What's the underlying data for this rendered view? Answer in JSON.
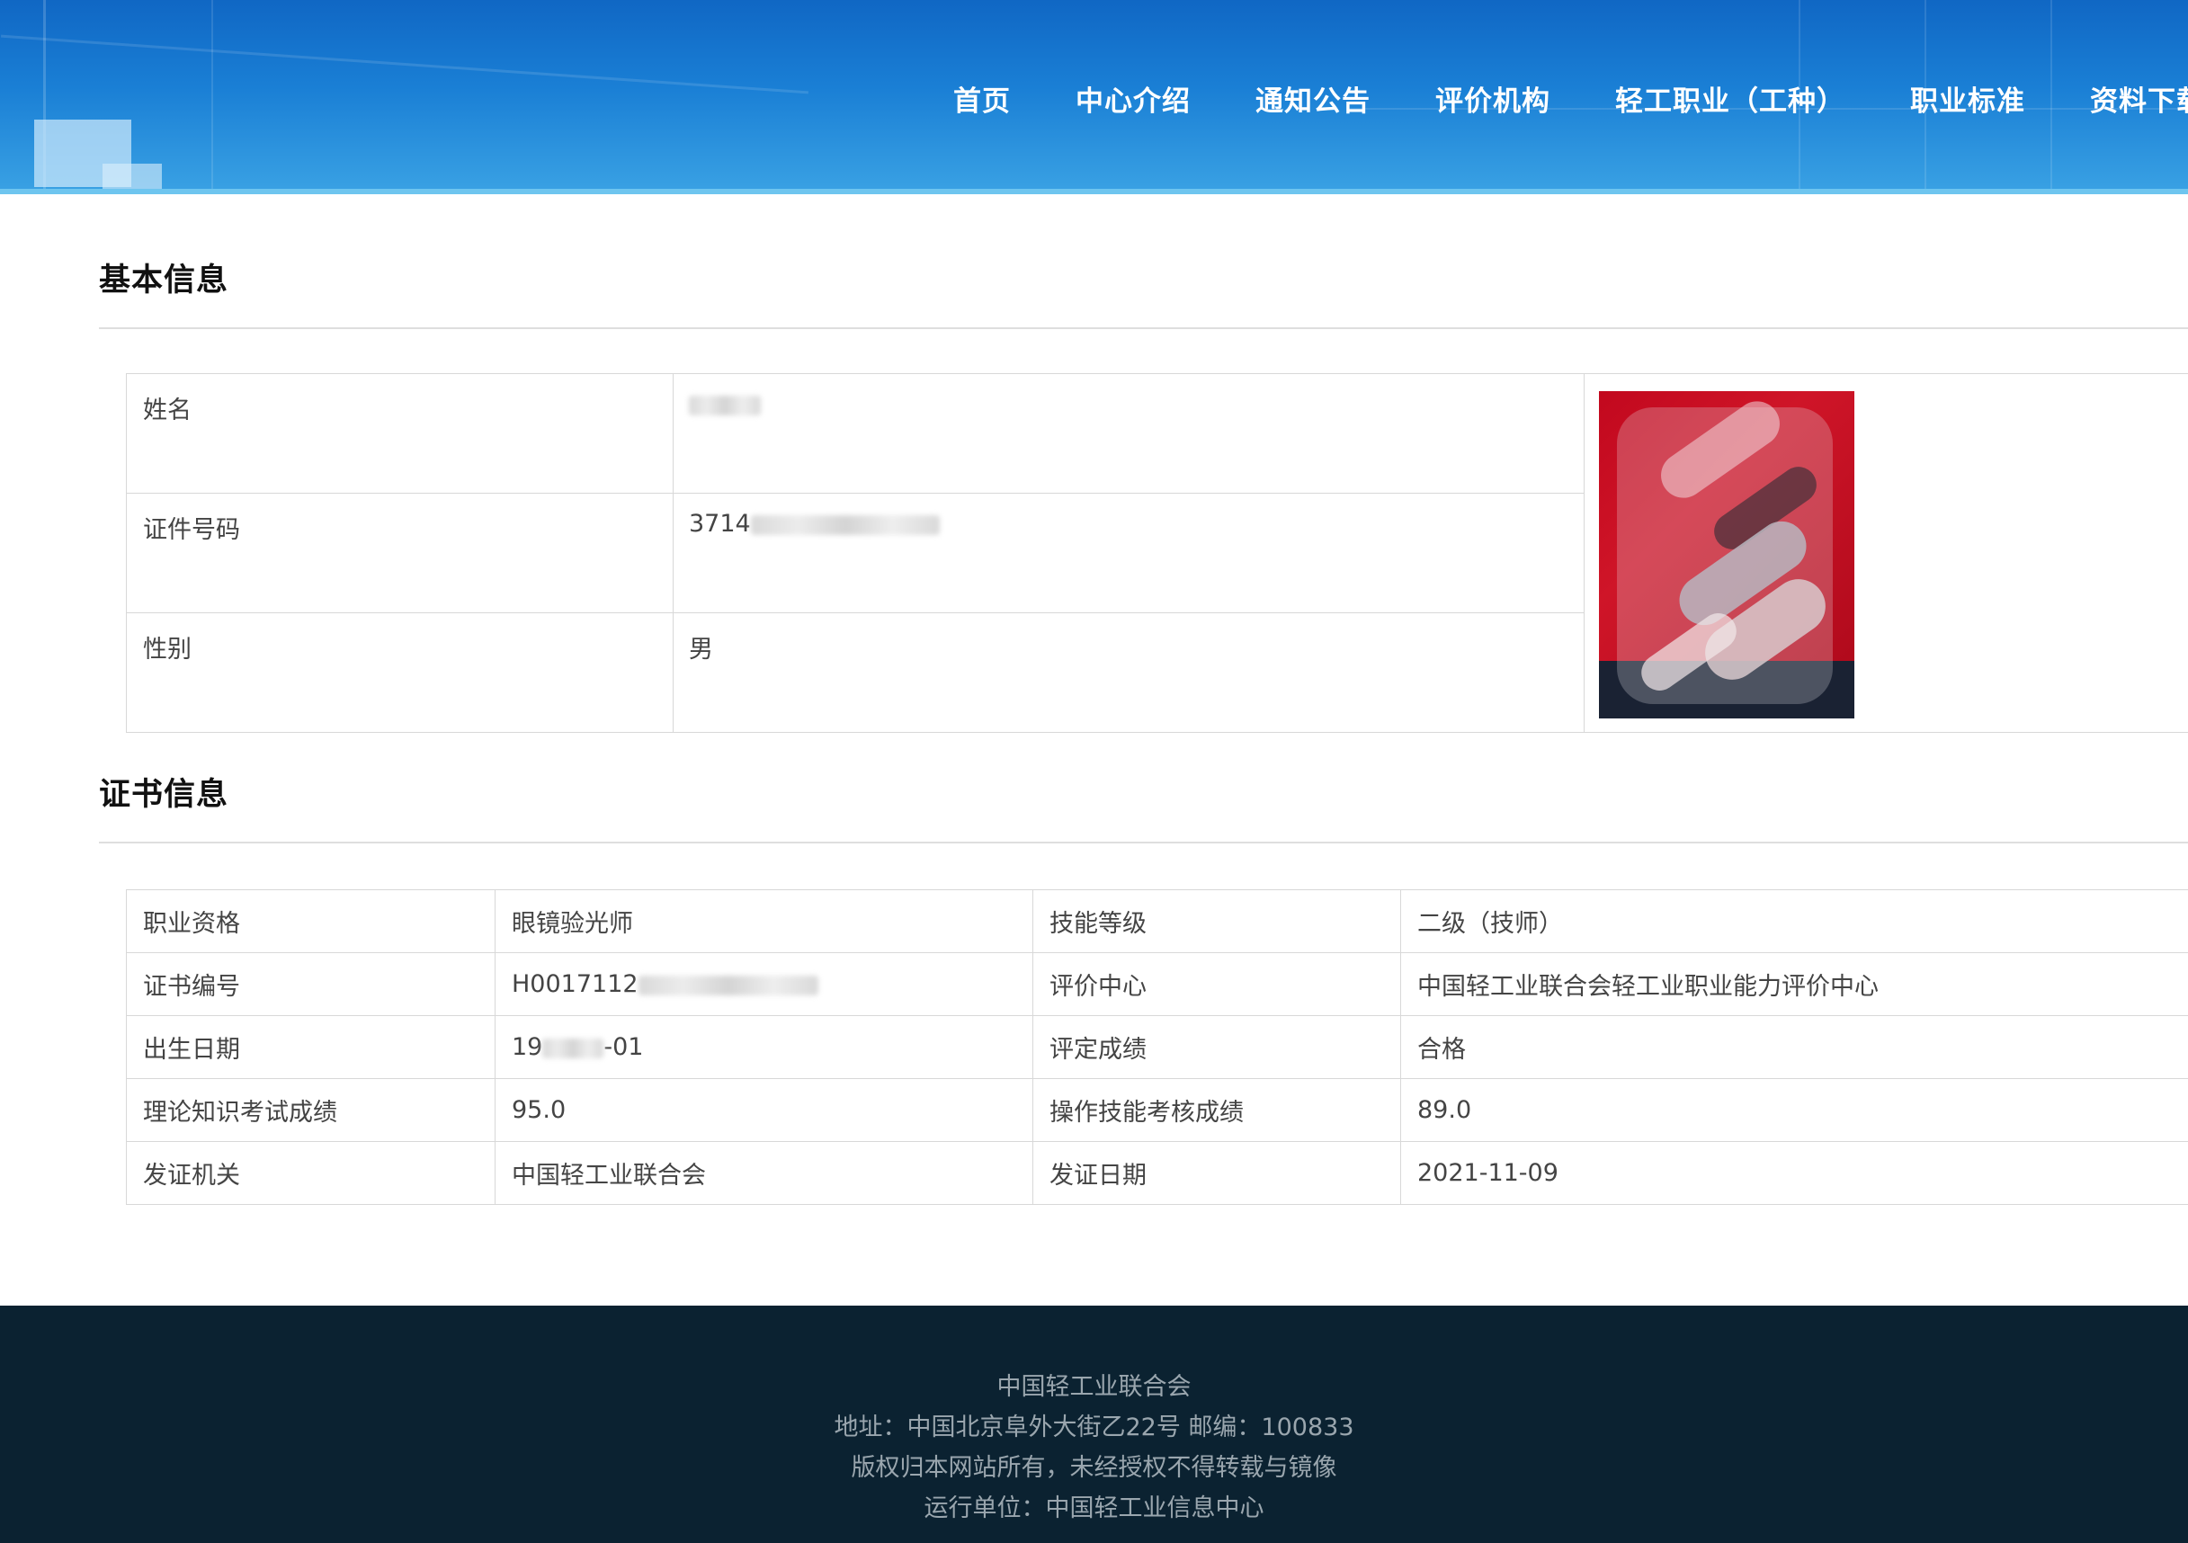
{
  "nav": {
    "items": [
      "首页",
      "中心介绍",
      "通知公告",
      "评价机构",
      "轻工职业（工种）",
      "职业标准",
      "资料下载"
    ]
  },
  "basic_info": {
    "title": "基本信息",
    "rows": [
      {
        "label": "姓名",
        "value": ""
      },
      {
        "label": "证件号码",
        "value": "3714"
      },
      {
        "label": "性别",
        "value": "男"
      }
    ]
  },
  "cert_info": {
    "title": "证书信息",
    "rows": [
      {
        "l1": "职业资格",
        "v1": "眼镜验光师",
        "l2": "技能等级",
        "v2": "二级（技师）"
      },
      {
        "l1": "证书编号",
        "v1": "H0017112",
        "l2": "评价中心",
        "v2": "中国轻工业联合会轻工业职业能力评价中心"
      },
      {
        "l1": "出生日期",
        "v1_prefix": "19",
        "v1_suffix": "-01",
        "l2": "评定成绩",
        "v2": "合格"
      },
      {
        "l1": "理论知识考试成绩",
        "v1": "95.0",
        "l2": "操作技能考核成绩",
        "v2": "89.0"
      },
      {
        "l1": "发证机关",
        "v1": "中国轻工业联合会",
        "l2": "发证日期",
        "v2": "2021-11-09"
      }
    ]
  },
  "footer": {
    "org": "中国轻工业联合会",
    "address": "地址：中国北京阜外大街乙22号 邮编：100833",
    "copyright": "版权归本网站所有，未经授权不得转载与镜像",
    "operator": "运行单位：中国轻工业信息中心"
  },
  "colors": {
    "header_blue": "#1a7fd5",
    "footer_bg": "#0b2231",
    "border": "#d8d8d8"
  }
}
